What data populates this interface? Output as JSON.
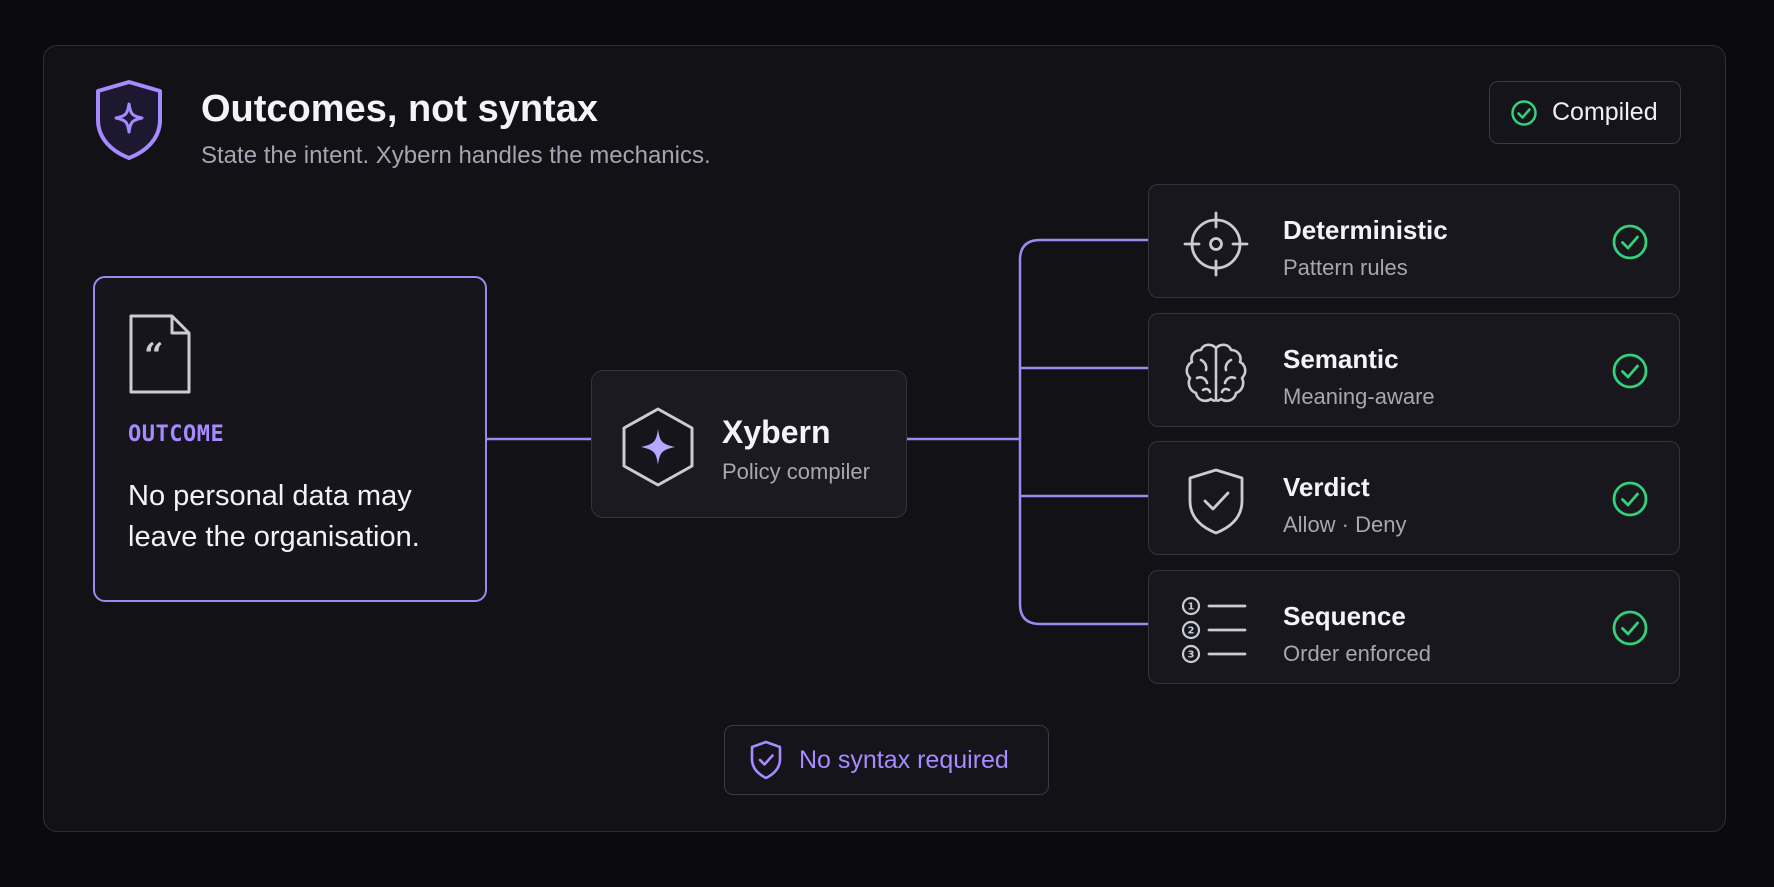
{
  "header": {
    "title": "Outcomes, not syntax",
    "subtitle": "State the intent. Xybern handles the mechanics.",
    "icon": "shield-sparkle-icon"
  },
  "status": {
    "label": "Compiled",
    "icon": "check-circle-icon",
    "color": "#34d17a"
  },
  "outcome": {
    "tag": "OUTCOME",
    "statement": "No personal data may leave the organisation.",
    "icon": "quote-document-icon"
  },
  "compiler": {
    "name": "Xybern",
    "description": "Policy compiler",
    "icon": "hexagon-sparkle-icon"
  },
  "checks": [
    {
      "name": "Deterministic",
      "description": "Pattern rules",
      "icon": "crosshair-icon"
    },
    {
      "name": "Semantic",
      "description": "Meaning-aware",
      "icon": "brain-icon"
    },
    {
      "name": "Verdict",
      "description": "Allow · Deny",
      "icon": "shield-check-icon"
    },
    {
      "name": "Sequence",
      "description": "Order enforced",
      "icon": "numbered-list-icon"
    }
  ],
  "footer": {
    "label": "No syntax required",
    "icon": "shield-check-icon"
  },
  "colors": {
    "accent": "#a58bff",
    "connector": "#9d89f0",
    "success": "#34d17a",
    "background": "#0b0b0f"
  }
}
